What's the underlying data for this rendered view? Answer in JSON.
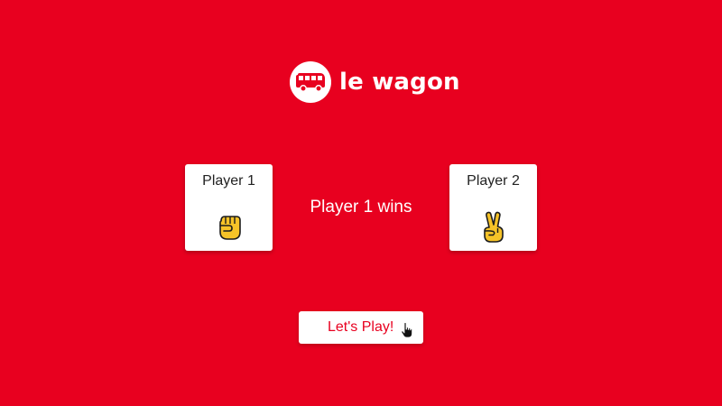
{
  "brand": {
    "name": "le wagon",
    "logo_icon": "bus-icon",
    "background_color": "#e8001f"
  },
  "players": [
    {
      "label": "Player 1",
      "choice": "rock",
      "icon": "fist-icon"
    },
    {
      "label": "Player 2",
      "choice": "scissors",
      "icon": "victory-hand-icon"
    }
  ],
  "result_text": "Player 1 wins",
  "play_button": {
    "label": "Let's Play!",
    "text_color": "#e8001f"
  },
  "cursor_icon": "hand-pointer-icon"
}
